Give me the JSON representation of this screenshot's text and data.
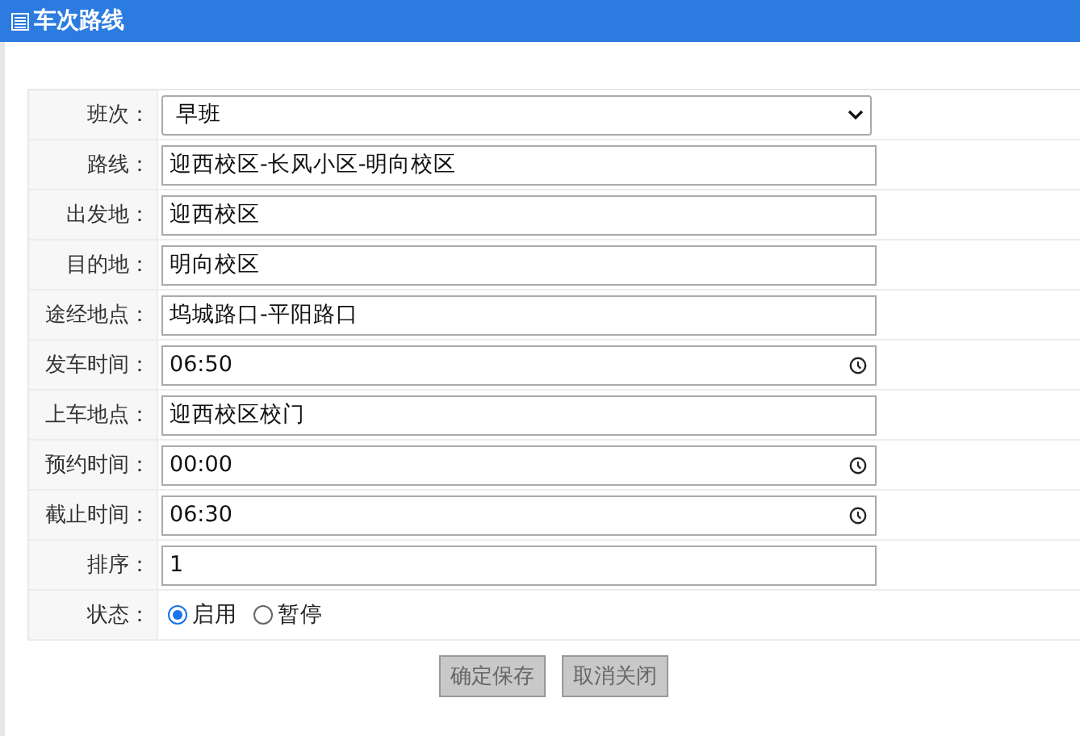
{
  "header": {
    "title": "车次路线"
  },
  "fields": [
    {
      "kind": "select",
      "label": "班次：",
      "value": "早班"
    },
    {
      "kind": "text",
      "label": "路线：",
      "value": "迎西校区-长风小区-明向校区"
    },
    {
      "kind": "text",
      "label": "出发地：",
      "value": "迎西校区"
    },
    {
      "kind": "text",
      "label": "目的地：",
      "value": "明向校区"
    },
    {
      "kind": "text",
      "label": "途经地点：",
      "value": "坞城路口-平阳路口"
    },
    {
      "kind": "time",
      "label": "发车时间：",
      "value": "06:50"
    },
    {
      "kind": "text",
      "label": "上车地点：",
      "value": "迎西校区校门"
    },
    {
      "kind": "time",
      "label": "预约时间：",
      "value": "00:00"
    },
    {
      "kind": "time",
      "label": "截止时间：",
      "value": "06:30"
    },
    {
      "kind": "text",
      "label": "排序：",
      "value": "1"
    },
    {
      "kind": "radio",
      "label": "状态：",
      "options": [
        {
          "label": "启用",
          "selected": true
        },
        {
          "label": "暂停",
          "selected": false
        }
      ]
    }
  ],
  "buttons": [
    {
      "label": "确定保存",
      "disabled": true
    },
    {
      "label": "取消关闭",
      "disabled": true
    }
  ]
}
